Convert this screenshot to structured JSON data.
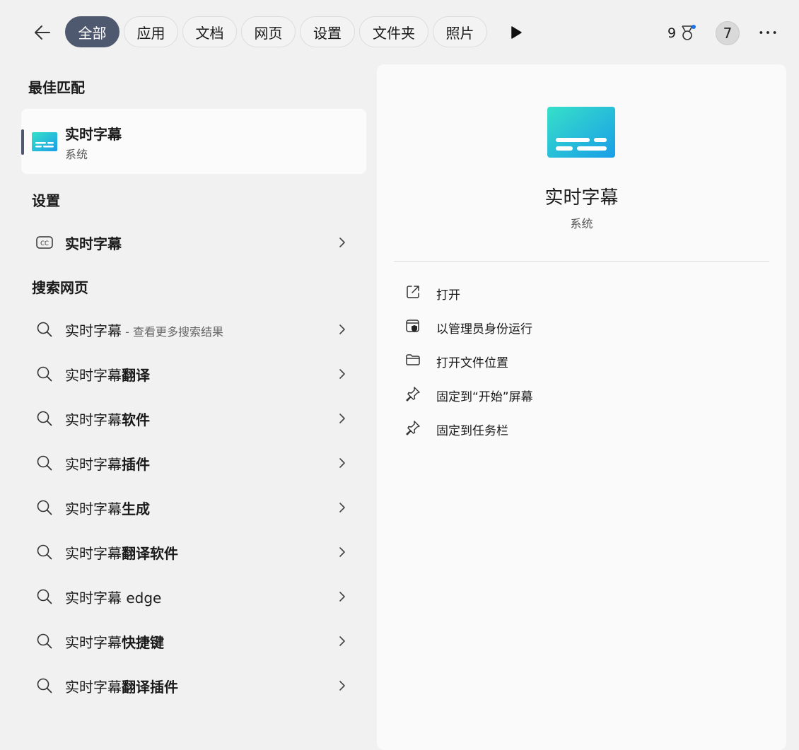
{
  "tabs": [
    "全部",
    "应用",
    "文档",
    "网页",
    "设置",
    "文件夹",
    "照片"
  ],
  "header": {
    "points": "9",
    "avatar_letter": "7"
  },
  "sections": {
    "best_match": "最佳匹配",
    "settings": "设置",
    "search_web": "搜索网页"
  },
  "best_match": {
    "name": "实时字幕",
    "type": "系统"
  },
  "settings_result": {
    "label": "实时字幕"
  },
  "web_results": [
    {
      "prefix": "实时字幕",
      "bold": "",
      "hint": "- 查看更多搜索结果"
    },
    {
      "prefix": "实时字幕",
      "bold": "翻译",
      "hint": ""
    },
    {
      "prefix": "实时字幕",
      "bold": "软件",
      "hint": ""
    },
    {
      "prefix": "实时字幕",
      "bold": "插件",
      "hint": ""
    },
    {
      "prefix": "实时字幕",
      "bold": "生成",
      "hint": ""
    },
    {
      "prefix": "实时字幕",
      "bold": "翻译软件",
      "hint": ""
    },
    {
      "prefix": "实时字幕 edge",
      "bold": "",
      "hint": ""
    },
    {
      "prefix": "实时字幕",
      "bold": "快捷键",
      "hint": ""
    },
    {
      "prefix": "实时字幕",
      "bold": "翻译插件",
      "hint": ""
    }
  ],
  "detail": {
    "title": "实时字幕",
    "subtitle": "系统",
    "actions": [
      {
        "label": "打开",
        "icon": "open-external-icon"
      },
      {
        "label": "以管理员身份运行",
        "icon": "run-as-admin-icon"
      },
      {
        "label": "打开文件位置",
        "icon": "folder-icon"
      },
      {
        "label": "固定到“开始”屏幕",
        "icon": "pin-icon"
      },
      {
        "label": "固定到任务栏",
        "icon": "pin-icon"
      }
    ]
  },
  "colors": {
    "accent": "#4e586e",
    "icon_gradient_start": "#36e0c8",
    "icon_gradient_end": "#1a9ee8"
  }
}
